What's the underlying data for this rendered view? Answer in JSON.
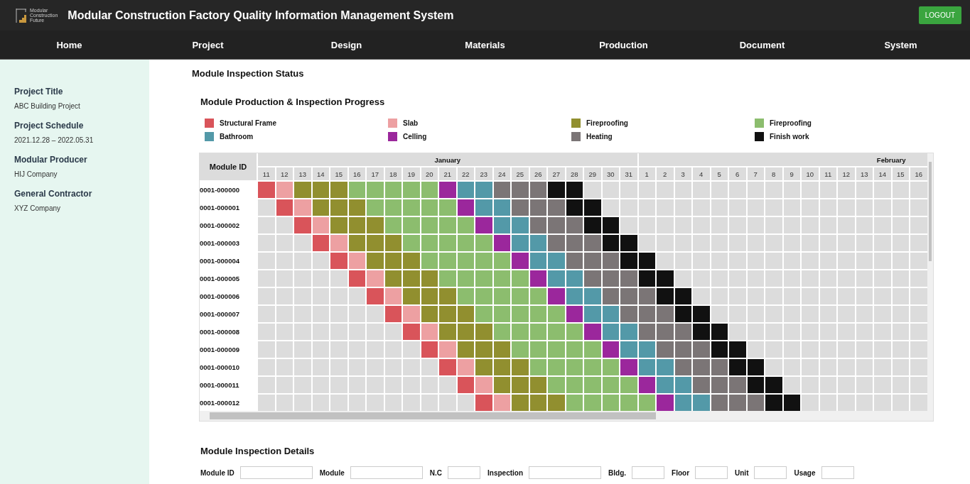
{
  "header": {
    "logo_lines": [
      "Modular",
      "Construction",
      "Future"
    ],
    "title": "Modular Construction Factory Quality Information Management System",
    "logout": "LOGOUT"
  },
  "nav": [
    {
      "label": "Home"
    },
    {
      "label": "Project"
    },
    {
      "label": "Design"
    },
    {
      "label": "Materials"
    },
    {
      "label": "Production"
    },
    {
      "label": "Document"
    },
    {
      "label": "System"
    }
  ],
  "sidebar": [
    {
      "label": "Project Title",
      "value": "ABC Building Project"
    },
    {
      "label": "Project Schedule",
      "value": "2021.12.28 – 2022.05.31"
    },
    {
      "label": "Modular Producer",
      "value": "HIJ Company"
    },
    {
      "label": "General Contractor",
      "value": "XYZ Company"
    }
  ],
  "page_title": "Module Inspection Status",
  "progress": {
    "title": "Module Production & Inspection Progress",
    "legend": [
      {
        "label": "Structural Frame",
        "color": "#d9545a",
        "kind": "frame"
      },
      {
        "label": "Slab",
        "color": "#eda0a2",
        "kind": "slab"
      },
      {
        "label": "Fireproofing",
        "color": "#918f2f",
        "kind": "fireA"
      },
      {
        "label": "Fireproofing",
        "color": "#8cbd6e",
        "kind": "fireB"
      },
      {
        "label": "Bathroom",
        "color": "#5399a8",
        "kind": "bath"
      },
      {
        "label": "Celling",
        "color": "#9b279c",
        "kind": "ceiling"
      },
      {
        "label": "Heating",
        "color": "#7b7576",
        "kind": "heating"
      },
      {
        "label": "Finish work",
        "color": "#111111",
        "kind": "finish"
      }
    ],
    "id_header": "Module ID",
    "months": [
      {
        "label": "January",
        "days": [
          "11",
          "12",
          "13",
          "14",
          "15",
          "16",
          "17",
          "18",
          "19",
          "20",
          "21",
          "22",
          "23",
          "24",
          "25",
          "26",
          "27",
          "28",
          "29",
          "30",
          "31"
        ]
      },
      {
        "label": "February",
        "days": [
          "1",
          "2",
          "3",
          "4",
          "5",
          "6",
          "7",
          "8",
          "9",
          "10",
          "11",
          "12",
          "13",
          "14",
          "15",
          "16"
        ]
      }
    ],
    "rows": [
      {
        "id": "0001-000000",
        "cells": [
          {
            "kind": "frame"
          },
          {
            "kind": "slab"
          },
          {
            "kind": "fireA"
          },
          {
            "kind": "fireA"
          },
          {
            "kind": "fireA"
          },
          {
            "kind": "fireB"
          },
          {
            "kind": "fireB"
          },
          {
            "kind": "fireB"
          },
          {
            "kind": "fireB"
          },
          {
            "kind": "fireB"
          },
          {
            "kind": "ceiling"
          },
          {
            "kind": "bath"
          },
          {
            "kind": "bath"
          },
          {
            "kind": "heating"
          },
          {
            "kind": "heating"
          },
          {
            "kind": "heating"
          },
          {
            "kind": "finish"
          },
          {
            "kind": "finish"
          }
        ]
      },
      {
        "id": "0001-000001",
        "cells": [
          {
            "kind": "none"
          },
          {
            "kind": "frame"
          },
          {
            "kind": "slab"
          },
          {
            "kind": "fireA"
          },
          {
            "kind": "fireA"
          },
          {
            "kind": "fireA"
          },
          {
            "kind": "fireB"
          },
          {
            "kind": "fireB"
          },
          {
            "kind": "fireB"
          },
          {
            "kind": "fireB"
          },
          {
            "kind": "fireB"
          },
          {
            "kind": "ceiling"
          },
          {
            "kind": "bath"
          },
          {
            "kind": "bath"
          },
          {
            "kind": "heating"
          },
          {
            "kind": "heating"
          },
          {
            "kind": "heating"
          },
          {
            "kind": "finish"
          },
          {
            "kind": "finish"
          }
        ]
      },
      {
        "id": "0001-000002",
        "cells": [
          {
            "kind": "none"
          },
          {
            "kind": "none"
          },
          {
            "kind": "frame"
          },
          {
            "kind": "slab"
          },
          {
            "kind": "fireA"
          },
          {
            "kind": "fireA"
          },
          {
            "kind": "fireA"
          },
          {
            "kind": "fireB"
          },
          {
            "kind": "fireB"
          },
          {
            "kind": "fireB"
          },
          {
            "kind": "fireB"
          },
          {
            "kind": "fireB"
          },
          {
            "kind": "ceiling"
          },
          {
            "kind": "bath"
          },
          {
            "kind": "bath"
          },
          {
            "kind": "heating"
          },
          {
            "kind": "heating"
          },
          {
            "kind": "heating"
          },
          {
            "kind": "finish"
          },
          {
            "kind": "finish"
          }
        ]
      },
      {
        "id": "0001-000003",
        "cells": [
          {
            "kind": "none"
          },
          {
            "kind": "none"
          },
          {
            "kind": "none"
          },
          {
            "kind": "frame"
          },
          {
            "kind": "slab"
          },
          {
            "kind": "fireA"
          },
          {
            "kind": "fireA"
          },
          {
            "kind": "fireA"
          },
          {
            "kind": "fireB"
          },
          {
            "kind": "fireB"
          },
          {
            "kind": "fireB"
          },
          {
            "kind": "fireB"
          },
          {
            "kind": "fireB"
          },
          {
            "kind": "ceiling"
          },
          {
            "kind": "bath"
          },
          {
            "kind": "bath"
          },
          {
            "kind": "heating"
          },
          {
            "kind": "heating"
          },
          {
            "kind": "heating"
          },
          {
            "kind": "finish"
          },
          {
            "kind": "finish"
          }
        ]
      },
      {
        "id": "0001-000004",
        "cells": [
          {
            "kind": "none"
          },
          {
            "kind": "none"
          },
          {
            "kind": "none"
          },
          {
            "kind": "none"
          },
          {
            "kind": "frame"
          },
          {
            "kind": "slab"
          },
          {
            "kind": "fireA"
          },
          {
            "kind": "fireA"
          },
          {
            "kind": "fireA"
          },
          {
            "kind": "fireB"
          },
          {
            "kind": "fireB"
          },
          {
            "kind": "fireB"
          },
          {
            "kind": "fireB"
          },
          {
            "kind": "fireB"
          },
          {
            "kind": "ceiling"
          },
          {
            "kind": "bath"
          },
          {
            "kind": "bath"
          },
          {
            "kind": "heating"
          },
          {
            "kind": "heating"
          },
          {
            "kind": "heating"
          },
          {
            "kind": "finish"
          },
          {
            "kind": "finish"
          }
        ]
      },
      {
        "id": "0001-000005",
        "cells": [
          {
            "kind": "none"
          },
          {
            "kind": "none"
          },
          {
            "kind": "none"
          },
          {
            "kind": "none"
          },
          {
            "kind": "none"
          },
          {
            "kind": "frame"
          },
          {
            "kind": "slab"
          },
          {
            "kind": "fireA"
          },
          {
            "kind": "fireA"
          },
          {
            "kind": "fireA"
          },
          {
            "kind": "fireB"
          },
          {
            "kind": "fireB"
          },
          {
            "kind": "fireB"
          },
          {
            "kind": "fireB"
          },
          {
            "kind": "fireB"
          },
          {
            "kind": "ceiling"
          },
          {
            "kind": "bath"
          },
          {
            "kind": "bath"
          },
          {
            "kind": "heating"
          },
          {
            "kind": "heating"
          },
          {
            "kind": "heating"
          },
          {
            "kind": "finish"
          },
          {
            "kind": "finish"
          }
        ]
      },
      {
        "id": "0001-000006",
        "cells": [
          {
            "kind": "none"
          },
          {
            "kind": "none"
          },
          {
            "kind": "none"
          },
          {
            "kind": "none"
          },
          {
            "kind": "none"
          },
          {
            "kind": "none"
          },
          {
            "kind": "frame"
          },
          {
            "kind": "slab"
          },
          {
            "kind": "fireA"
          },
          {
            "kind": "fireA"
          },
          {
            "kind": "fireA"
          },
          {
            "kind": "fireB"
          },
          {
            "kind": "fireB"
          },
          {
            "kind": "fireB"
          },
          {
            "kind": "fireB"
          },
          {
            "kind": "fireB"
          },
          {
            "kind": "ceiling"
          },
          {
            "kind": "bath"
          },
          {
            "kind": "bath"
          },
          {
            "kind": "heating"
          },
          {
            "kind": "heating"
          },
          {
            "kind": "heating"
          },
          {
            "kind": "finish"
          },
          {
            "kind": "finish"
          }
        ]
      },
      {
        "id": "0001-000007",
        "cells": [
          {
            "kind": "none"
          },
          {
            "kind": "none"
          },
          {
            "kind": "none"
          },
          {
            "kind": "none"
          },
          {
            "kind": "none"
          },
          {
            "kind": "none"
          },
          {
            "kind": "none"
          },
          {
            "kind": "frame"
          },
          {
            "kind": "slab"
          },
          {
            "kind": "fireA"
          },
          {
            "kind": "fireA"
          },
          {
            "kind": "fireA"
          },
          {
            "kind": "fireB"
          },
          {
            "kind": "fireB"
          },
          {
            "kind": "fireB"
          },
          {
            "kind": "fireB"
          },
          {
            "kind": "fireB"
          },
          {
            "kind": "ceiling"
          },
          {
            "kind": "bath"
          },
          {
            "kind": "bath"
          },
          {
            "kind": "heating"
          },
          {
            "kind": "heating"
          },
          {
            "kind": "heating"
          },
          {
            "kind": "finish"
          },
          {
            "kind": "finish"
          }
        ]
      },
      {
        "id": "0001-000008",
        "cells": [
          {
            "kind": "none"
          },
          {
            "kind": "none"
          },
          {
            "kind": "none"
          },
          {
            "kind": "none"
          },
          {
            "kind": "none"
          },
          {
            "kind": "none"
          },
          {
            "kind": "none"
          },
          {
            "kind": "none"
          },
          {
            "kind": "frame"
          },
          {
            "kind": "slab"
          },
          {
            "kind": "fireA"
          },
          {
            "kind": "fireA"
          },
          {
            "kind": "fireA"
          },
          {
            "kind": "fireB"
          },
          {
            "kind": "fireB"
          },
          {
            "kind": "fireB"
          },
          {
            "kind": "fireB"
          },
          {
            "kind": "fireB"
          },
          {
            "kind": "ceiling"
          },
          {
            "kind": "bath"
          },
          {
            "kind": "bath"
          },
          {
            "kind": "heating"
          },
          {
            "kind": "heating"
          },
          {
            "kind": "heating"
          },
          {
            "kind": "finish"
          },
          {
            "kind": "finish"
          }
        ]
      },
      {
        "id": "0001-000009",
        "cells": [
          {
            "kind": "none"
          },
          {
            "kind": "none"
          },
          {
            "kind": "none"
          },
          {
            "kind": "none"
          },
          {
            "kind": "none"
          },
          {
            "kind": "none"
          },
          {
            "kind": "none"
          },
          {
            "kind": "none"
          },
          {
            "kind": "none"
          },
          {
            "kind": "frame"
          },
          {
            "kind": "slab"
          },
          {
            "kind": "fireA"
          },
          {
            "kind": "fireA"
          },
          {
            "kind": "fireA"
          },
          {
            "kind": "fireB"
          },
          {
            "kind": "fireB"
          },
          {
            "kind": "fireB"
          },
          {
            "kind": "fireB"
          },
          {
            "kind": "fireB"
          },
          {
            "kind": "ceiling"
          },
          {
            "kind": "bath"
          },
          {
            "kind": "bath"
          },
          {
            "kind": "heating"
          },
          {
            "kind": "heating"
          },
          {
            "kind": "heating"
          },
          {
            "kind": "finish"
          },
          {
            "kind": "finish"
          }
        ]
      },
      {
        "id": "0001-000010",
        "cells": [
          {
            "kind": "none"
          },
          {
            "kind": "none"
          },
          {
            "kind": "none"
          },
          {
            "kind": "none"
          },
          {
            "kind": "none"
          },
          {
            "kind": "none"
          },
          {
            "kind": "none"
          },
          {
            "kind": "none"
          },
          {
            "kind": "none"
          },
          {
            "kind": "none"
          },
          {
            "kind": "frame"
          },
          {
            "kind": "slab"
          },
          {
            "kind": "fireA"
          },
          {
            "kind": "fireA"
          },
          {
            "kind": "fireA"
          },
          {
            "kind": "fireB"
          },
          {
            "kind": "fireB"
          },
          {
            "kind": "fireB"
          },
          {
            "kind": "fireB"
          },
          {
            "kind": "fireB"
          },
          {
            "kind": "ceiling"
          },
          {
            "kind": "bath"
          },
          {
            "kind": "bath"
          },
          {
            "kind": "heating"
          },
          {
            "kind": "heating"
          },
          {
            "kind": "heating"
          },
          {
            "kind": "finish"
          },
          {
            "kind": "finish"
          }
        ]
      },
      {
        "id": "0001-000011",
        "cells": [
          {
            "kind": "none"
          },
          {
            "kind": "none"
          },
          {
            "kind": "none"
          },
          {
            "kind": "none"
          },
          {
            "kind": "none"
          },
          {
            "kind": "none"
          },
          {
            "kind": "none"
          },
          {
            "kind": "none"
          },
          {
            "kind": "none"
          },
          {
            "kind": "none"
          },
          {
            "kind": "none"
          },
          {
            "kind": "frame"
          },
          {
            "kind": "slab"
          },
          {
            "kind": "fireA"
          },
          {
            "kind": "fireA"
          },
          {
            "kind": "fireA"
          },
          {
            "kind": "fireB"
          },
          {
            "kind": "fireB"
          },
          {
            "kind": "fireB"
          },
          {
            "kind": "fireB"
          },
          {
            "kind": "fireB"
          },
          {
            "kind": "ceiling"
          },
          {
            "kind": "bath"
          },
          {
            "kind": "bath"
          },
          {
            "kind": "heating"
          },
          {
            "kind": "heating"
          },
          {
            "kind": "heating"
          },
          {
            "kind": "finish"
          },
          {
            "kind": "finish"
          }
        ]
      },
      {
        "id": "0001-000012",
        "cells": [
          {
            "kind": "none"
          },
          {
            "kind": "none"
          },
          {
            "kind": "none"
          },
          {
            "kind": "none"
          },
          {
            "kind": "none"
          },
          {
            "kind": "none"
          },
          {
            "kind": "none"
          },
          {
            "kind": "none"
          },
          {
            "kind": "none"
          },
          {
            "kind": "none"
          },
          {
            "kind": "none"
          },
          {
            "kind": "none"
          },
          {
            "kind": "frame"
          },
          {
            "kind": "slab"
          },
          {
            "kind": "fireA"
          },
          {
            "kind": "fireA"
          },
          {
            "kind": "fireA"
          },
          {
            "kind": "fireB"
          },
          {
            "kind": "fireB"
          },
          {
            "kind": "fireB"
          },
          {
            "kind": "fireB"
          },
          {
            "kind": "fireB"
          },
          {
            "kind": "ceiling"
          },
          {
            "kind": "bath"
          },
          {
            "kind": "bath"
          },
          {
            "kind": "heating"
          },
          {
            "kind": "heating"
          },
          {
            "kind": "heating"
          },
          {
            "kind": "finish"
          },
          {
            "kind": "finish"
          }
        ]
      }
    ]
  },
  "details": {
    "title": "Module Inspection Details",
    "fields": [
      {
        "label": "Module ID",
        "kind": "wide"
      },
      {
        "label": "Module",
        "kind": "wide"
      },
      {
        "label": "N.C",
        "kind": "small"
      },
      {
        "label": "Inspection",
        "kind": "wide"
      },
      {
        "label": "Bldg.",
        "kind": "small"
      },
      {
        "label": "Floor",
        "kind": "small"
      },
      {
        "label": "Unit",
        "kind": "small"
      },
      {
        "label": "Usage",
        "kind": "small"
      }
    ]
  }
}
